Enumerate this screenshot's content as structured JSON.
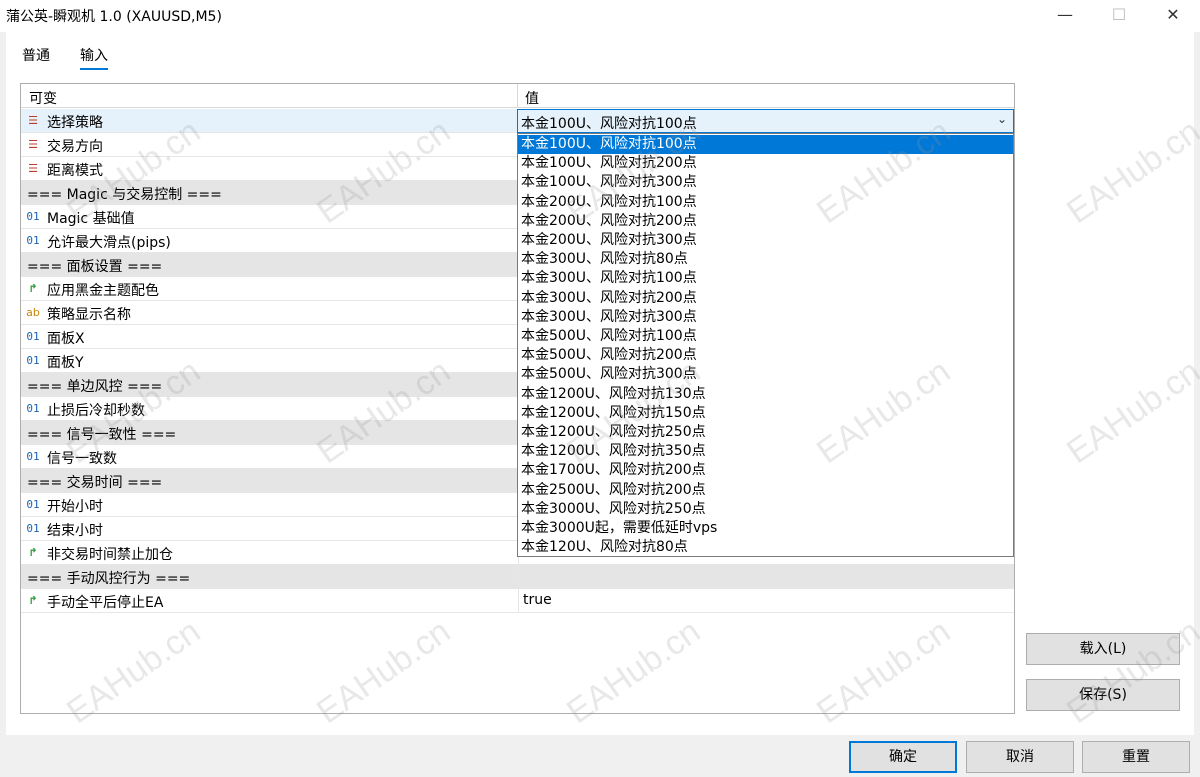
{
  "window": {
    "title": "蒲公英-瞬观机 1.0 (XAUUSD,M5)",
    "minimize": "—",
    "maximize": "☐",
    "close": "✕"
  },
  "tabs": [
    {
      "label": "普通",
      "active": false
    },
    {
      "label": "输入",
      "active": true
    }
  ],
  "grid": {
    "col_name": "可变",
    "col_value": "值",
    "rows": [
      {
        "name": "选择策略",
        "icon": "enum-icon",
        "value": "本金100U、风险对抗100点",
        "section": false
      },
      {
        "name": "交易方向",
        "icon": "enum-icon",
        "value": "",
        "section": false
      },
      {
        "name": "距离模式",
        "icon": "enum-icon",
        "value": "",
        "section": false
      },
      {
        "name": "=== Magic 与交易控制 ===",
        "icon": "",
        "value": "",
        "section": true
      },
      {
        "name": "Magic 基础值",
        "icon": "int-icon",
        "value": "",
        "section": false
      },
      {
        "name": "允许最大滑点(pips)",
        "icon": "int-icon",
        "value": "",
        "section": false
      },
      {
        "name": "=== 面板设置 ===",
        "icon": "",
        "value": "",
        "section": true
      },
      {
        "name": "应用黑金主题配色",
        "icon": "bool-icon",
        "value": "",
        "section": false
      },
      {
        "name": "策略显示名称",
        "icon": "string-icon",
        "value": "",
        "section": false
      },
      {
        "name": "面板X",
        "icon": "int-icon",
        "value": "",
        "section": false
      },
      {
        "name": "面板Y",
        "icon": "int-icon",
        "value": "",
        "section": false
      },
      {
        "name": "=== 单边风控 ===",
        "icon": "",
        "value": "",
        "section": true
      },
      {
        "name": "止损后冷却秒数",
        "icon": "int-icon",
        "value": "",
        "section": false
      },
      {
        "name": "=== 信号一致性 ===",
        "icon": "",
        "value": "",
        "section": true
      },
      {
        "name": "信号一致数",
        "icon": "int-icon",
        "value": "",
        "section": false
      },
      {
        "name": "=== 交易时间 ===",
        "icon": "",
        "value": "",
        "section": true
      },
      {
        "name": "开始小时",
        "icon": "int-icon",
        "value": "",
        "section": false
      },
      {
        "name": "结束小时",
        "icon": "int-icon",
        "value": "",
        "section": false
      },
      {
        "name": "非交易时间禁止加仓",
        "icon": "bool-icon",
        "value": "",
        "section": false
      },
      {
        "name": "=== 手动风控行为 ===",
        "icon": "",
        "value": "",
        "section": true
      },
      {
        "name": "手动全平后停止EA",
        "icon": "bool-icon",
        "value": "true",
        "section": false
      }
    ]
  },
  "combo": {
    "selected": "本金100U、风险对抗100点",
    "options": [
      "本金100U、风险对抗100点",
      "本金100U、风险对抗200点",
      "本金100U、风险对抗300点",
      "本金200U、风险对抗100点",
      "本金200U、风险对抗200点",
      "本金200U、风险对抗300点",
      "本金300U、风险对抗80点",
      "本金300U、风险对抗100点",
      "本金300U、风险对抗200点",
      "本金300U、风险对抗300点",
      "本金500U、风险对抗100点",
      "本金500U、风险对抗200点",
      "本金500U、风险对抗300点",
      "本金1200U、风险对抗130点",
      "本金1200U、风险对抗150点",
      "本金1200U、风险对抗250点",
      "本金1200U、风险对抗350点",
      "本金1700U、风险对抗200点",
      "本金2500U、风险对抗200点",
      "本金3000U、风险对抗250点",
      "本金3000U起，需要低延时vps",
      "本金120U、风险对抗80点"
    ],
    "highlighted_index": 0
  },
  "side_buttons": {
    "load": "载入(L)",
    "save": "保存(S)"
  },
  "bottom_buttons": {
    "ok": "确定",
    "cancel": "取消",
    "reset": "重置"
  },
  "watermark": "EAHub.cn",
  "colors": {
    "accent": "#0078d7",
    "section_bg": "#e5e5e5",
    "selected_row": "#e5f1fb"
  }
}
